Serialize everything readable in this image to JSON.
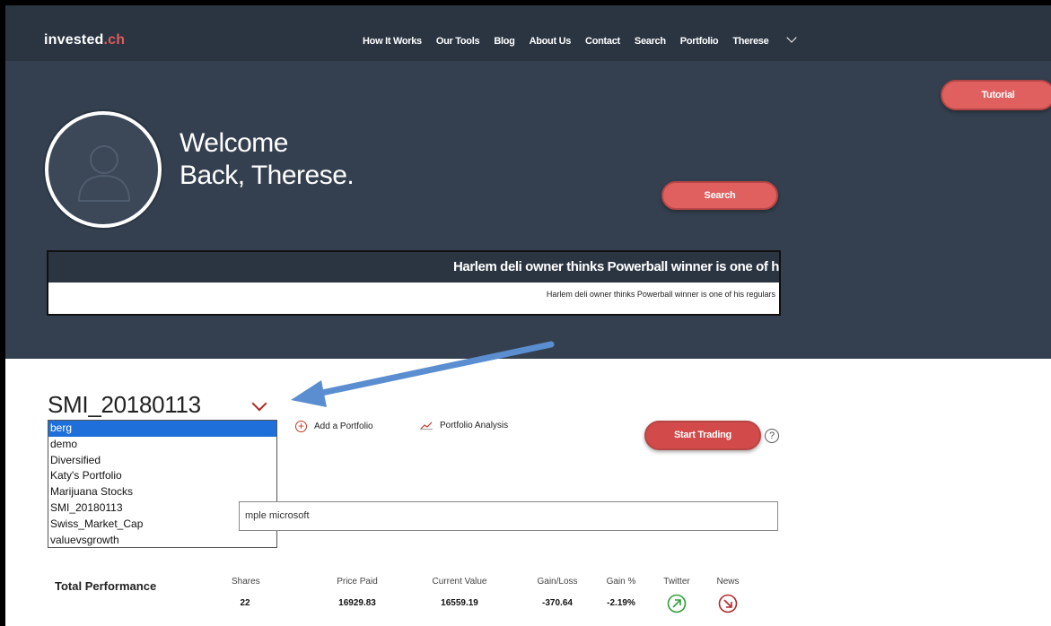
{
  "nav": {
    "logo_main": "invested",
    "logo_suffix": ".ch",
    "links": [
      "How It Works",
      "Our Tools",
      "Blog",
      "About Us",
      "Contact",
      "Search",
      "Portfolio"
    ],
    "user_menu": "Therese"
  },
  "hero": {
    "tutorial_label": "Tutorial",
    "welcome_line1": "Welcome",
    "welcome_line2": "Back, Therese.",
    "search_label": "Search",
    "news_headline": "Harlem deli owner thinks Powerball winner is one of h",
    "news_sub": "Harlem deli owner thinks Powerball winner is one of his regulars"
  },
  "portfolio": {
    "selected": "SMI_20180113",
    "options": [
      "berg",
      "demo",
      "Diversified",
      "Katy's Portfolio",
      "Marijuana Stocks",
      "SMI_20180113",
      "Swiss_Market_Cap",
      "valuevsgrowth"
    ],
    "highlighted_option": "berg",
    "add_label": "Add a Portfolio",
    "analysis_label": "Portfolio Analysis",
    "start_trading_label": "Start Trading",
    "help_label": "?",
    "search_visible_text": "mple microsoft"
  },
  "performance": {
    "label": "Total Performance",
    "columns": [
      {
        "header": "Shares",
        "value": "22"
      },
      {
        "header": "Price Paid",
        "value": "16929.83"
      },
      {
        "header": "Current Value",
        "value": "16559.19"
      },
      {
        "header": "Gain/Loss",
        "value": "-370.64"
      },
      {
        "header": "Gain %",
        "value": "-2.19%"
      }
    ],
    "twitter_label": "Twitter",
    "news_label": "News",
    "twitter_color": "#2e9e3a",
    "news_color": "#b02828"
  },
  "annotation_arrow_color": "#5b8ed0"
}
